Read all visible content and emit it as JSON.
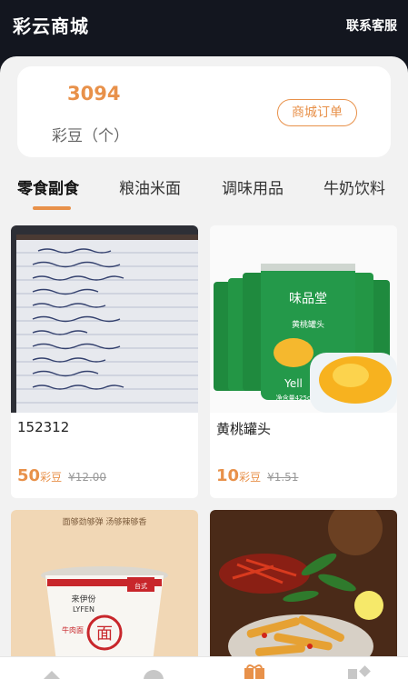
{
  "header": {
    "title": "彩云商城",
    "service_label": "联系客服"
  },
  "balance": {
    "value": "3094",
    "label": "彩豆（个）",
    "orders_button": "商城订单"
  },
  "tabs": [
    {
      "label": "零食副食",
      "active": true
    },
    {
      "label": "粮油米面",
      "active": false
    },
    {
      "label": "调味用品",
      "active": false
    },
    {
      "label": "牛奶饮料",
      "active": false
    }
  ],
  "products": [
    {
      "name": "152312",
      "price": "50",
      "unit": "彩豆",
      "original_price": "¥12.00",
      "image_icon": "notebook-photo-icon"
    },
    {
      "name": "黄桃罐头",
      "price": "10",
      "unit": "彩豆",
      "original_price": "¥1.51",
      "image_icon": "canned-peach-photo-icon"
    },
    {
      "name": "",
      "price": "",
      "unit": "",
      "original_price": "",
      "image_icon": "instant-noodle-photo-icon",
      "image_text": {
        "banner": "面够劲够弹 汤够辣够香",
        "brand": "来伊份",
        "brand_en": "LYFEN",
        "flavor": "牛肉面",
        "badge": "面",
        "corner": "台式"
      }
    },
    {
      "name": "",
      "price": "",
      "unit": "",
      "original_price": "",
      "image_icon": "spicy-snack-photo-icon"
    }
  ],
  "peach_can_text": {
    "brand": "味品堂",
    "product": "黄桃罐头",
    "logo": "Yell",
    "weight": "净含量425g"
  },
  "colors": {
    "accent": "#e8914a",
    "header_bg": "#13161f",
    "panel_bg": "#f2f2f2"
  },
  "nav": [
    {
      "icon": "home-icon"
    },
    {
      "icon": "circle-icon"
    },
    {
      "icon": "gift-icon",
      "active": true
    },
    {
      "icon": "category-icon"
    }
  ]
}
